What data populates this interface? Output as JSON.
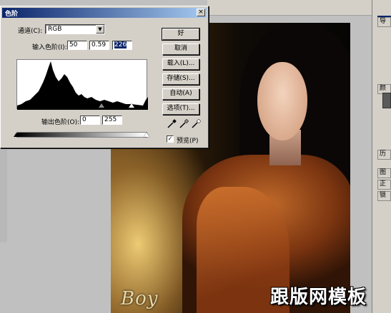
{
  "dialog": {
    "title": "色阶",
    "close_glyph": "×",
    "channel_label": "通道(C):",
    "channel_value": "RGB",
    "input_levels_label": "输入色阶(I):",
    "input_black": "50",
    "input_gamma": "0.59",
    "input_white": "226",
    "output_levels_label": "输出色阶(O):",
    "output_black": "0",
    "output_white": "255",
    "buttons": {
      "ok": "好",
      "cancel": "取消",
      "load": "载入(L)...",
      "save": "存储(S)...",
      "auto": "自动(A)",
      "options": "选项(T)..."
    },
    "preview_label": "预览(P)",
    "preview_checked": "✓"
  },
  "palette": {
    "panel_labels": [
      "导",
      "颜",
      "历",
      "图"
    ],
    "panel_bottom_label": "正",
    "panel_lock_label": "锁"
  },
  "poster": {
    "title_text": "Boy",
    "watermark": "跟版网模板"
  },
  "colors": {
    "titlebar": "#0a246a",
    "dialog_bg": "#d4d0c8"
  }
}
